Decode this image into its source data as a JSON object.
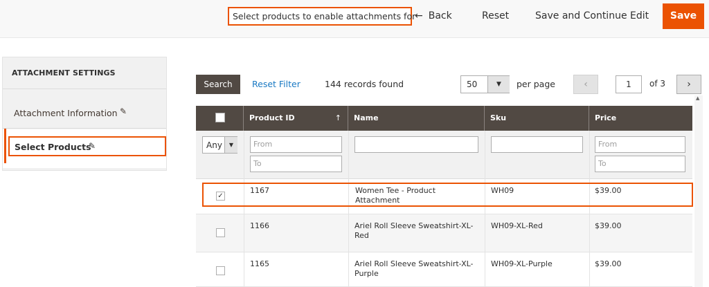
{
  "header": {
    "title": "Select products to enable attachments for",
    "back_label": "Back",
    "reset_label": "Reset",
    "save_continue_label": "Save and Continue Edit",
    "save_label": "Save"
  },
  "sidebar": {
    "title": "ATTACHMENT SETTINGS",
    "items": [
      {
        "label": "Attachment Information"
      },
      {
        "label": "Select Products"
      }
    ]
  },
  "toolbar": {
    "search_label": "Search",
    "reset_filter_label": "Reset Filter",
    "records_found": "144 records found",
    "per_page_value": "50",
    "per_page_label": "per page",
    "current_page": "1",
    "page_total": "of 3"
  },
  "table": {
    "columns": [
      "Product ID",
      "Name",
      "Sku",
      "Price"
    ],
    "filter": {
      "any_value": "Any",
      "from_placeholder": "From",
      "to_placeholder": "To"
    },
    "rows": [
      {
        "checked": true,
        "id": "1167",
        "name": "Women Tee - Product Attachment",
        "sku": "WH09",
        "price": "$39.00"
      },
      {
        "checked": false,
        "id": "1166",
        "name": "Ariel Roll Sleeve Sweatshirt-XL-Red",
        "sku": "WH09-XL-Red",
        "price": "$39.00"
      },
      {
        "checked": false,
        "id": "1165",
        "name": "Ariel Roll Sleeve Sweatshirt-XL-Purple",
        "sku": "WH09-XL-Purple",
        "price": "$39.00"
      }
    ]
  },
  "colors": {
    "accent": "#eb5202",
    "header_dark": "#514943",
    "link": "#1979c3"
  }
}
